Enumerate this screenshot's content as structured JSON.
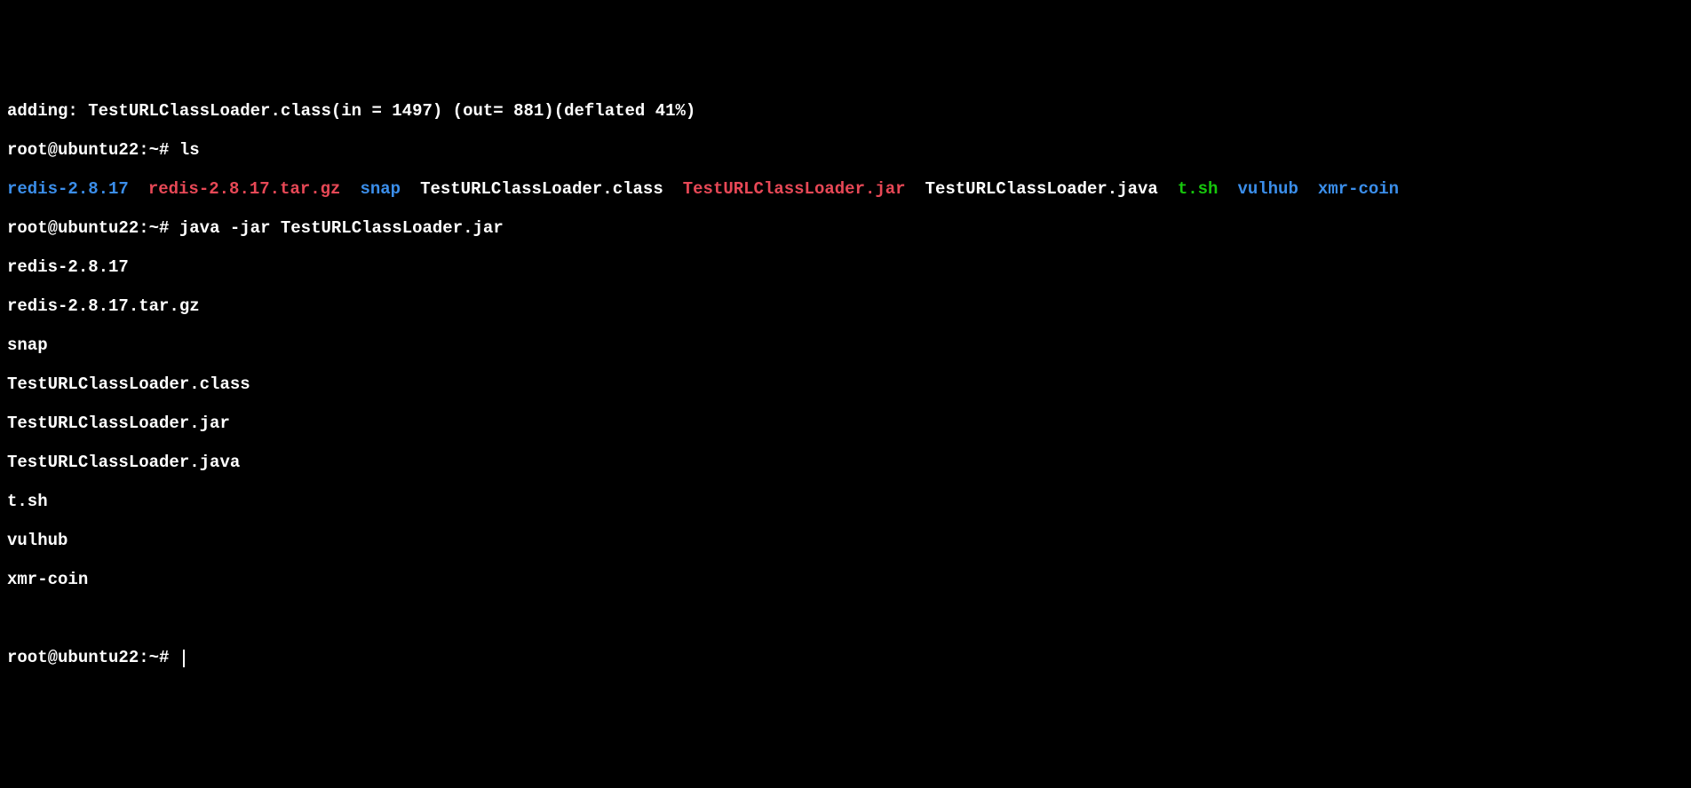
{
  "lines": {
    "adding": "adding: TestURLClassLoader.class(in = 1497) (out= 881)(deflated 41%)",
    "prompt1_prefix": "root@ubuntu22",
    "prompt1_sep": ":",
    "prompt1_path": "~",
    "prompt1_hash": "# ",
    "cmd1": "ls",
    "prompt2_prefix": "root@ubuntu22",
    "prompt2_sep": ":",
    "prompt2_path": "~",
    "prompt2_hash": "# ",
    "cmd2": "java -jar TestURLClassLoader.jar",
    "out1": "redis-2.8.17",
    "out2": "redis-2.8.17.tar.gz",
    "out3": "snap",
    "out4": "TestURLClassLoader.class",
    "out5": "TestURLClassLoader.jar",
    "out6": "TestURLClassLoader.java",
    "out7": "t.sh",
    "out8": "vulhub",
    "out9": "xmr-coin",
    "prompt3_prefix": "root@ubuntu22",
    "prompt3_sep": ":",
    "prompt3_path": "~",
    "prompt3_hash": "# "
  },
  "ls": {
    "i1": "redis-2.8.17",
    "i2": "redis-2.8.17.tar.gz",
    "i3": "snap",
    "i4": "TestURLClassLoader.class",
    "i5": "TestURLClassLoader.jar",
    "i6": "TestURLClassLoader.java",
    "i7": "t.sh",
    "i8": "vulhub",
    "i9": "xmr-coin"
  }
}
